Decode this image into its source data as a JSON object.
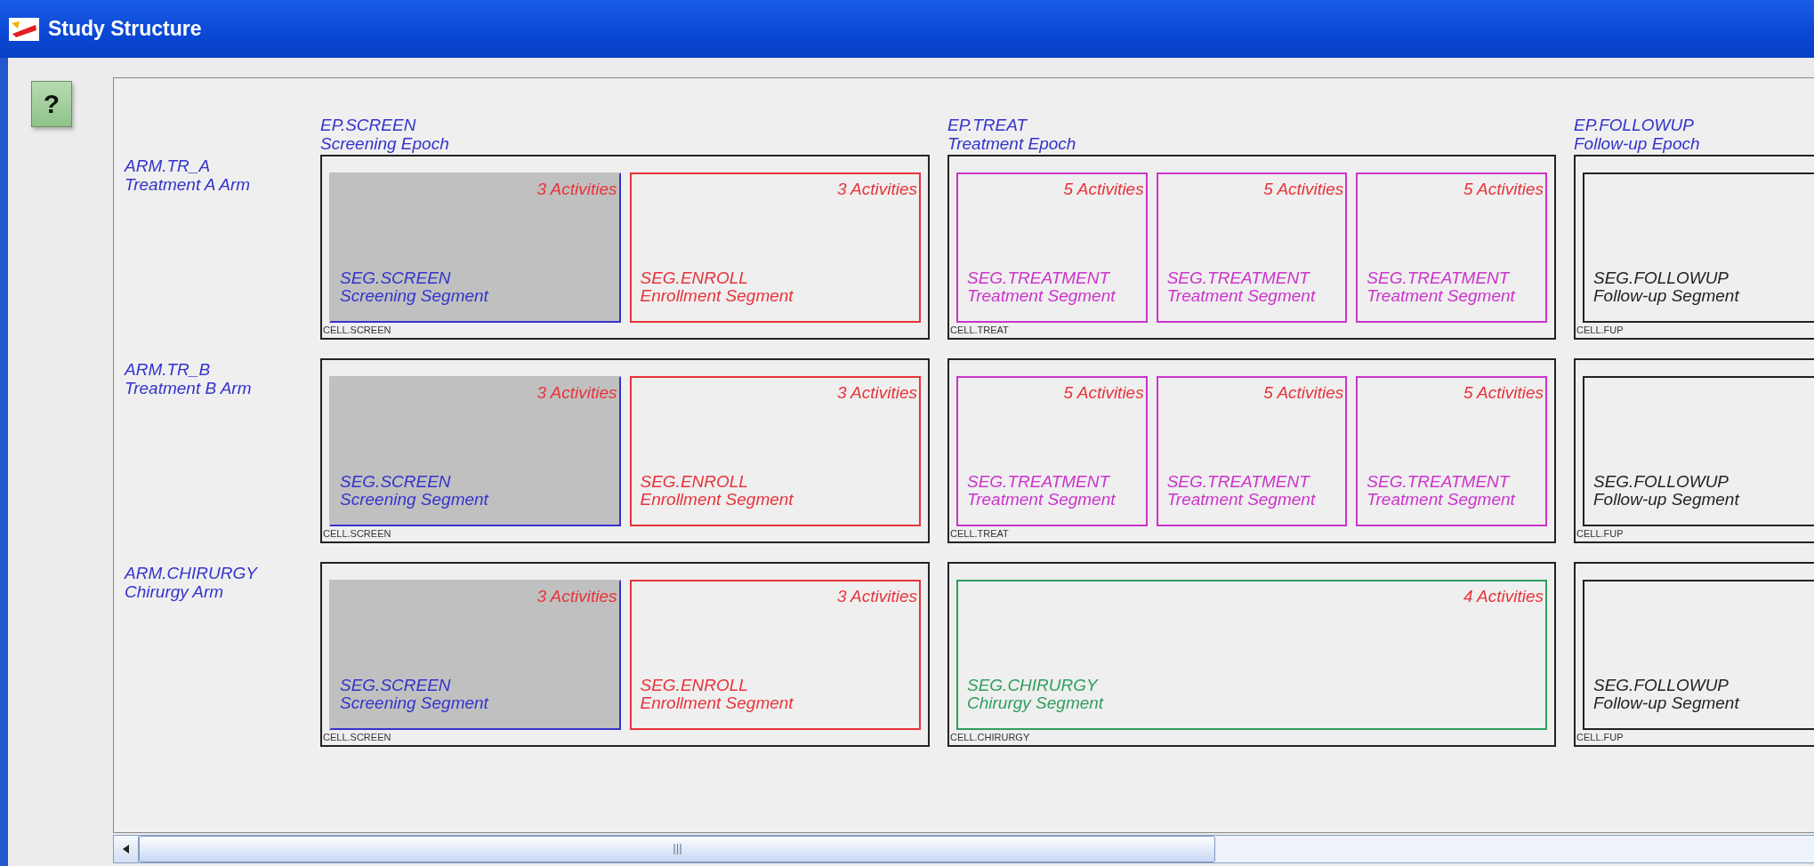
{
  "window": {
    "title": "Study Structure"
  },
  "help_button": {
    "label": "?"
  },
  "epochs": [
    {
      "code": "EP.SCREEN",
      "name": "Screening Epoch"
    },
    {
      "code": "EP.TREAT",
      "name": "Treatment Epoch"
    },
    {
      "code": "EP.FOLLOWUP",
      "name": "Follow-up Epoch"
    }
  ],
  "arms": [
    {
      "code": "ARM.TR_A",
      "name": "Treatment A Arm",
      "cells": [
        {
          "label": "CELL.SCREEN",
          "segments": [
            {
              "code": "SEG.SCREEN",
              "name": "Screening Segment",
              "activities": "3 Activities",
              "color": "#3333cc",
              "highlighted": true
            },
            {
              "code": "SEG.ENROLL",
              "name": "Enrollment Segment",
              "activities": "3 Activities",
              "color": "#e8333a",
              "highlighted": false
            }
          ]
        },
        {
          "label": "CELL.TREAT",
          "segments": [
            {
              "code": "SEG.TREATMENT",
              "name": "Treatment Segment",
              "activities": "5 Activities",
              "color": "#cc33cc",
              "highlighted": false
            },
            {
              "code": "SEG.TREATMENT",
              "name": "Treatment Segment",
              "activities": "5 Activities",
              "color": "#cc33cc",
              "highlighted": false
            },
            {
              "code": "SEG.TREATMENT",
              "name": "Treatment Segment",
              "activities": "5 Activities",
              "color": "#cc33cc",
              "highlighted": false
            }
          ]
        },
        {
          "label": "CELL.FUP",
          "segments": [
            {
              "code": "SEG.FOLLOWUP",
              "name": "Follow-up Segment",
              "color": "#222222",
              "highlighted": false
            }
          ]
        }
      ]
    },
    {
      "code": "ARM.TR_B",
      "name": "Treatment B Arm",
      "cells": [
        {
          "label": "CELL.SCREEN",
          "segments": [
            {
              "code": "SEG.SCREEN",
              "name": "Screening Segment",
              "activities": "3 Activities",
              "color": "#3333cc",
              "highlighted": true
            },
            {
              "code": "SEG.ENROLL",
              "name": "Enrollment Segment",
              "activities": "3 Activities",
              "color": "#e8333a",
              "highlighted": false
            }
          ]
        },
        {
          "label": "CELL.TREAT",
          "segments": [
            {
              "code": "SEG.TREATMENT",
              "name": "Treatment Segment",
              "activities": "5 Activities",
              "color": "#cc33cc",
              "highlighted": false
            },
            {
              "code": "SEG.TREATMENT",
              "name": "Treatment Segment",
              "activities": "5 Activities",
              "color": "#cc33cc",
              "highlighted": false
            },
            {
              "code": "SEG.TREATMENT",
              "name": "Treatment Segment",
              "activities": "5 Activities",
              "color": "#cc33cc",
              "highlighted": false
            }
          ]
        },
        {
          "label": "CELL.FUP",
          "segments": [
            {
              "code": "SEG.FOLLOWUP",
              "name": "Follow-up Segment",
              "color": "#222222",
              "highlighted": false
            }
          ]
        }
      ]
    },
    {
      "code": "ARM.CHIRURGY",
      "name": "Chirurgy Arm",
      "cells": [
        {
          "label": "CELL.SCREEN",
          "segments": [
            {
              "code": "SEG.SCREEN",
              "name": "Screening Segment",
              "activities": "3 Activities",
              "color": "#3333cc",
              "highlighted": true
            },
            {
              "code": "SEG.ENROLL",
              "name": "Enrollment Segment",
              "activities": "3 Activities",
              "color": "#e8333a",
              "highlighted": false
            }
          ]
        },
        {
          "label": "CELL.CHIRURGY",
          "segments": [
            {
              "code": "SEG.CHIRURGY",
              "name": "Chirurgy Segment",
              "activities": "4 Activities",
              "color": "#2e9e5e",
              "highlighted": false
            }
          ]
        },
        {
          "label": "CELL.FUP",
          "segments": [
            {
              "code": "SEG.FOLLOWUP",
              "name": "Follow-up Segment",
              "color": "#222222",
              "highlighted": false
            }
          ]
        }
      ]
    }
  ]
}
